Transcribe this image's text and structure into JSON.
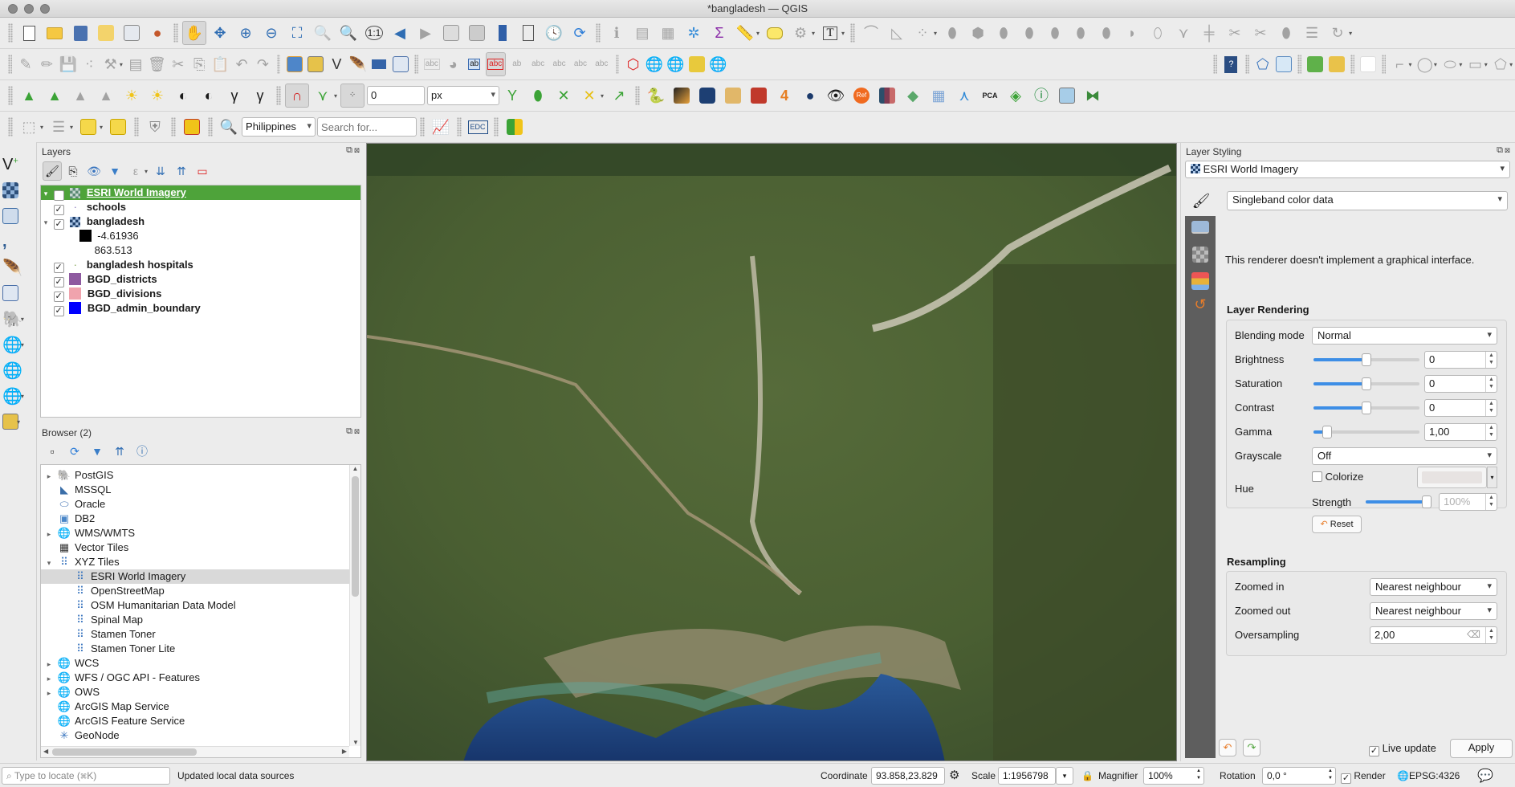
{
  "window": {
    "title": "*bangladesh — QGIS"
  },
  "toolbars": {
    "row1": [
      "new-project",
      "open-project",
      "save-project",
      "new-print-layout",
      "layout-manager",
      "style-manager",
      "pan-map",
      "pan-to-selection",
      "zoom-in",
      "zoom-out",
      "zoom-full",
      "zoom-to-selection",
      "zoom-to-layer",
      "zoom-native",
      "zoom-last",
      "zoom-next",
      "new-map-view",
      "new-3d-map-view",
      "new-bookmark",
      "show-bookmarks",
      "temporal-controller",
      "refresh",
      "identify",
      "open-attribute-table",
      "statistical-summary",
      "processing-toolbox",
      "sum",
      "measure",
      "map-tips",
      "action",
      "text-annotation",
      "digitize",
      "angle",
      "pt-displacement",
      "reshape",
      "offset",
      "rotate",
      "add-ring",
      "add-part",
      "fill-ring",
      "delete-ring",
      "delete-part",
      "reshape-features",
      "offset-curve",
      "split",
      "split-parts",
      "merge",
      "merge-attributes",
      "rotate-point",
      "simplify"
    ],
    "snap_tolerance_value": "0",
    "snap_unit": "px",
    "geocoder_country": "Philippines",
    "geocoder_placeholder": "Search for...",
    "edc_label": "EDC"
  },
  "layers_panel": {
    "title": "Layers",
    "items": [
      {
        "name": "ESRI World Imagery",
        "checked": true,
        "expanded": true,
        "selected": true,
        "type": "raster"
      },
      {
        "name": "schools",
        "checked": true,
        "type": "point",
        "color": "#8a78b8"
      },
      {
        "name": "bangladesh",
        "checked": true,
        "expanded": true,
        "type": "raster"
      },
      {
        "name": "-4.61936",
        "type": "legend",
        "color": "#000000"
      },
      {
        "name": "863.513",
        "type": "legend"
      },
      {
        "name": "bangladesh hospitals",
        "checked": true,
        "type": "point",
        "color": "#7da14a"
      },
      {
        "name": "BGD_districts",
        "checked": true,
        "type": "polygon",
        "color": "#8e5aa0"
      },
      {
        "name": "BGD_divisions",
        "checked": true,
        "type": "polygon",
        "color": "#f0a3ad"
      },
      {
        "name": "BGD_admin_boundary",
        "checked": true,
        "type": "polygon",
        "color": "#0000ff"
      }
    ]
  },
  "browser_panel": {
    "title": "Browser (2)",
    "items": [
      {
        "label": "PostGIS",
        "caret": "right",
        "level": 0,
        "icon": "postgis-icon"
      },
      {
        "label": "MSSQL",
        "caret": "",
        "level": 0,
        "icon": "mssql-icon"
      },
      {
        "label": "Oracle",
        "caret": "",
        "level": 0,
        "icon": "oracle-icon"
      },
      {
        "label": "DB2",
        "caret": "",
        "level": 0,
        "icon": "db2-icon"
      },
      {
        "label": "WMS/WMTS",
        "caret": "right",
        "level": 0,
        "icon": "wms-icon"
      },
      {
        "label": "Vector Tiles",
        "caret": "",
        "level": 0,
        "icon": "vector-tiles-icon"
      },
      {
        "label": "XYZ Tiles",
        "caret": "down",
        "level": 0,
        "icon": "xyz-tiles-icon"
      },
      {
        "label": "ESRI World Imagery",
        "caret": "",
        "level": 1,
        "icon": "xyz-tile-icon",
        "selected": true
      },
      {
        "label": "OpenStreetMap",
        "caret": "",
        "level": 1,
        "icon": "xyz-tile-icon"
      },
      {
        "label": "OSM Humanitarian Data Model",
        "caret": "",
        "level": 1,
        "icon": "xyz-tile-icon"
      },
      {
        "label": "Spinal Map",
        "caret": "",
        "level": 1,
        "icon": "xyz-tile-icon"
      },
      {
        "label": "Stamen Toner",
        "caret": "",
        "level": 1,
        "icon": "xyz-tile-icon"
      },
      {
        "label": "Stamen Toner Lite",
        "caret": "",
        "level": 1,
        "icon": "xyz-tile-icon"
      },
      {
        "label": "WCS",
        "caret": "right",
        "level": 0,
        "icon": "wcs-icon"
      },
      {
        "label": "WFS / OGC API - Features",
        "caret": "right",
        "level": 0,
        "icon": "wfs-icon"
      },
      {
        "label": "OWS",
        "caret": "right",
        "level": 0,
        "icon": "ows-icon"
      },
      {
        "label": "ArcGIS Map Service",
        "caret": "",
        "level": 0,
        "icon": "arcgis-map-icon"
      },
      {
        "label": "ArcGIS Feature Service",
        "caret": "",
        "level": 0,
        "icon": "arcgis-feature-icon"
      },
      {
        "label": "GeoNode",
        "caret": "",
        "level": 0,
        "icon": "geonode-icon"
      }
    ]
  },
  "layer_styling": {
    "title": "Layer Styling",
    "layer": "ESRI World Imagery",
    "renderer": "Singleband color data",
    "no_gui_message": "This renderer doesn't implement a graphical interface.",
    "layer_rendering_title": "Layer Rendering",
    "blending_mode_label": "Blending mode",
    "blending_mode": "Normal",
    "brightness_label": "Brightness",
    "brightness": "0",
    "brightness_slider": 0.5,
    "saturation_label": "Saturation",
    "saturation": "0",
    "saturation_slider": 0.5,
    "contrast_label": "Contrast",
    "contrast": "0",
    "contrast_slider": 0.5,
    "gamma_label": "Gamma",
    "gamma": "1,00",
    "gamma_slider": 0.13,
    "grayscale_label": "Grayscale",
    "grayscale": "Off",
    "hue_label": "Hue",
    "colorize_label": "Colorize",
    "colorize_checked": false,
    "strength_label": "Strength",
    "strength": "100%",
    "strength_slider": 1.0,
    "reset_label": "Reset",
    "resampling_title": "Resampling",
    "zoomed_in_label": "Zoomed in",
    "zoomed_in": "Nearest neighbour",
    "zoomed_out_label": "Zoomed out",
    "zoomed_out": "Nearest neighbour",
    "oversampling_label": "Oversampling",
    "oversampling": "2,00",
    "live_update_label": "Live update",
    "live_update_checked": true,
    "apply_label": "Apply"
  },
  "statusbar": {
    "locator_placeholder": "Type to locate (⌘K)",
    "message": "Updated local data sources",
    "coordinate_label": "Coordinate",
    "coordinate": "93.858,23.829",
    "scale_label": "Scale",
    "scale": "1:1956798",
    "magnifier_label": "Magnifier",
    "magnifier": "100%",
    "rotation_label": "Rotation",
    "rotation": "0,0 °",
    "render_label": "Render",
    "render_checked": true,
    "crs": "EPSG:4326"
  },
  "colors": {
    "selection_green": "#4ea33a",
    "accent_blue": "#3d8ee6",
    "sidebar_dark": "#5e5e5e"
  }
}
